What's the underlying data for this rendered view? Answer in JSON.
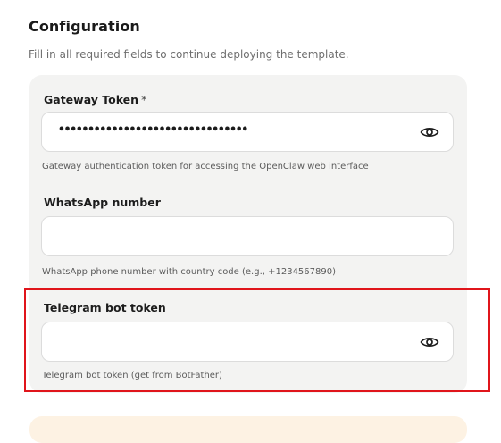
{
  "section": {
    "title": "Configuration",
    "subtitle": "Fill in all required fields to continue deploying the template."
  },
  "fields": [
    {
      "label": "Gateway Token",
      "required_mark": "*",
      "value": "••••••••••••••••••••••••••••••••",
      "placeholder": "",
      "helper": "Gateway authentication token for accessing the OpenClaw web interface",
      "has_visibility_toggle": true,
      "toggle_icon": "eye-icon"
    },
    {
      "label": "WhatsApp number",
      "value": "",
      "placeholder": "",
      "helper": "WhatsApp phone number with country code (e.g., +1234567890)",
      "has_visibility_toggle": false
    },
    {
      "label": "Telegram bot token",
      "value": "",
      "placeholder": "",
      "helper": "Telegram bot token (get from BotFather)",
      "has_visibility_toggle": true,
      "toggle_icon": "eye-icon",
      "highlighted": true
    }
  ],
  "colors": {
    "card_background": "#f3f3f2",
    "highlight_border": "#e0151b",
    "next_card_background": "#fdf2e3"
  }
}
